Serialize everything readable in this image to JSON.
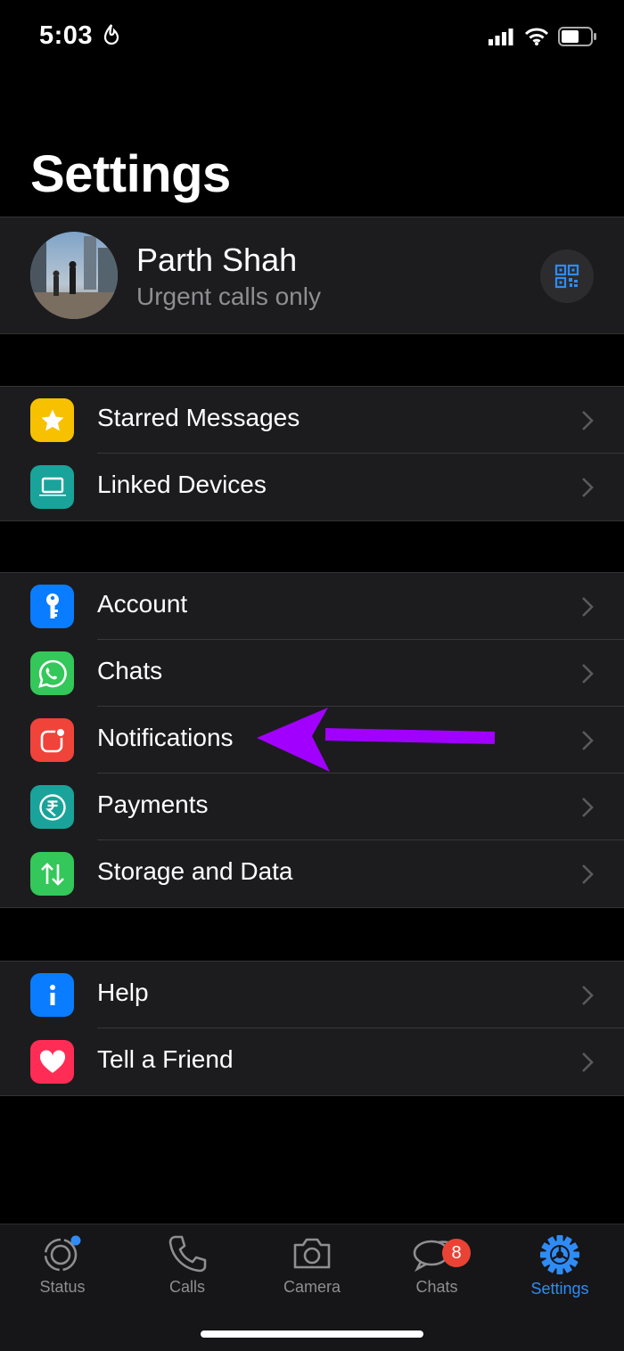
{
  "status_bar": {
    "time": "5:03"
  },
  "page": {
    "title": "Settings"
  },
  "profile": {
    "name": "Parth Shah",
    "status": "Urgent calls only"
  },
  "groups": [
    {
      "items": [
        {
          "label": "Starred Messages",
          "icon": "star-icon",
          "color": "#f7c100"
        },
        {
          "label": "Linked Devices",
          "icon": "laptop-icon",
          "color": "#1aa39a"
        }
      ]
    },
    {
      "items": [
        {
          "label": "Account",
          "icon": "key-icon",
          "color": "#0a7cff"
        },
        {
          "label": "Chats",
          "icon": "whatsapp-icon",
          "color": "#34c759"
        },
        {
          "label": "Notifications",
          "icon": "notification-icon",
          "color": "#f0433a"
        },
        {
          "label": "Payments",
          "icon": "rupee-icon",
          "color": "#1aa39a"
        },
        {
          "label": "Storage and Data",
          "icon": "arrows-updown-icon",
          "color": "#34c759"
        }
      ]
    },
    {
      "items": [
        {
          "label": "Help",
          "icon": "info-icon",
          "color": "#0a7cff"
        },
        {
          "label": "Tell a Friend",
          "icon": "heart-icon",
          "color": "#ff2d55"
        }
      ]
    }
  ],
  "annotation": {
    "icon": "arrow-pointer",
    "color": "#a100ff"
  },
  "tabs": [
    {
      "label": "Status",
      "icon": "status-icon"
    },
    {
      "label": "Calls",
      "icon": "phone-icon"
    },
    {
      "label": "Camera",
      "icon": "camera-icon"
    },
    {
      "label": "Chats",
      "icon": "chat-bubbles-icon",
      "badge": "8"
    },
    {
      "label": "Settings",
      "icon": "gear-icon",
      "active": true
    }
  ],
  "colors": {
    "accent": "#2f8cf6",
    "background": "#000000",
    "cell": "#1c1c1e"
  }
}
